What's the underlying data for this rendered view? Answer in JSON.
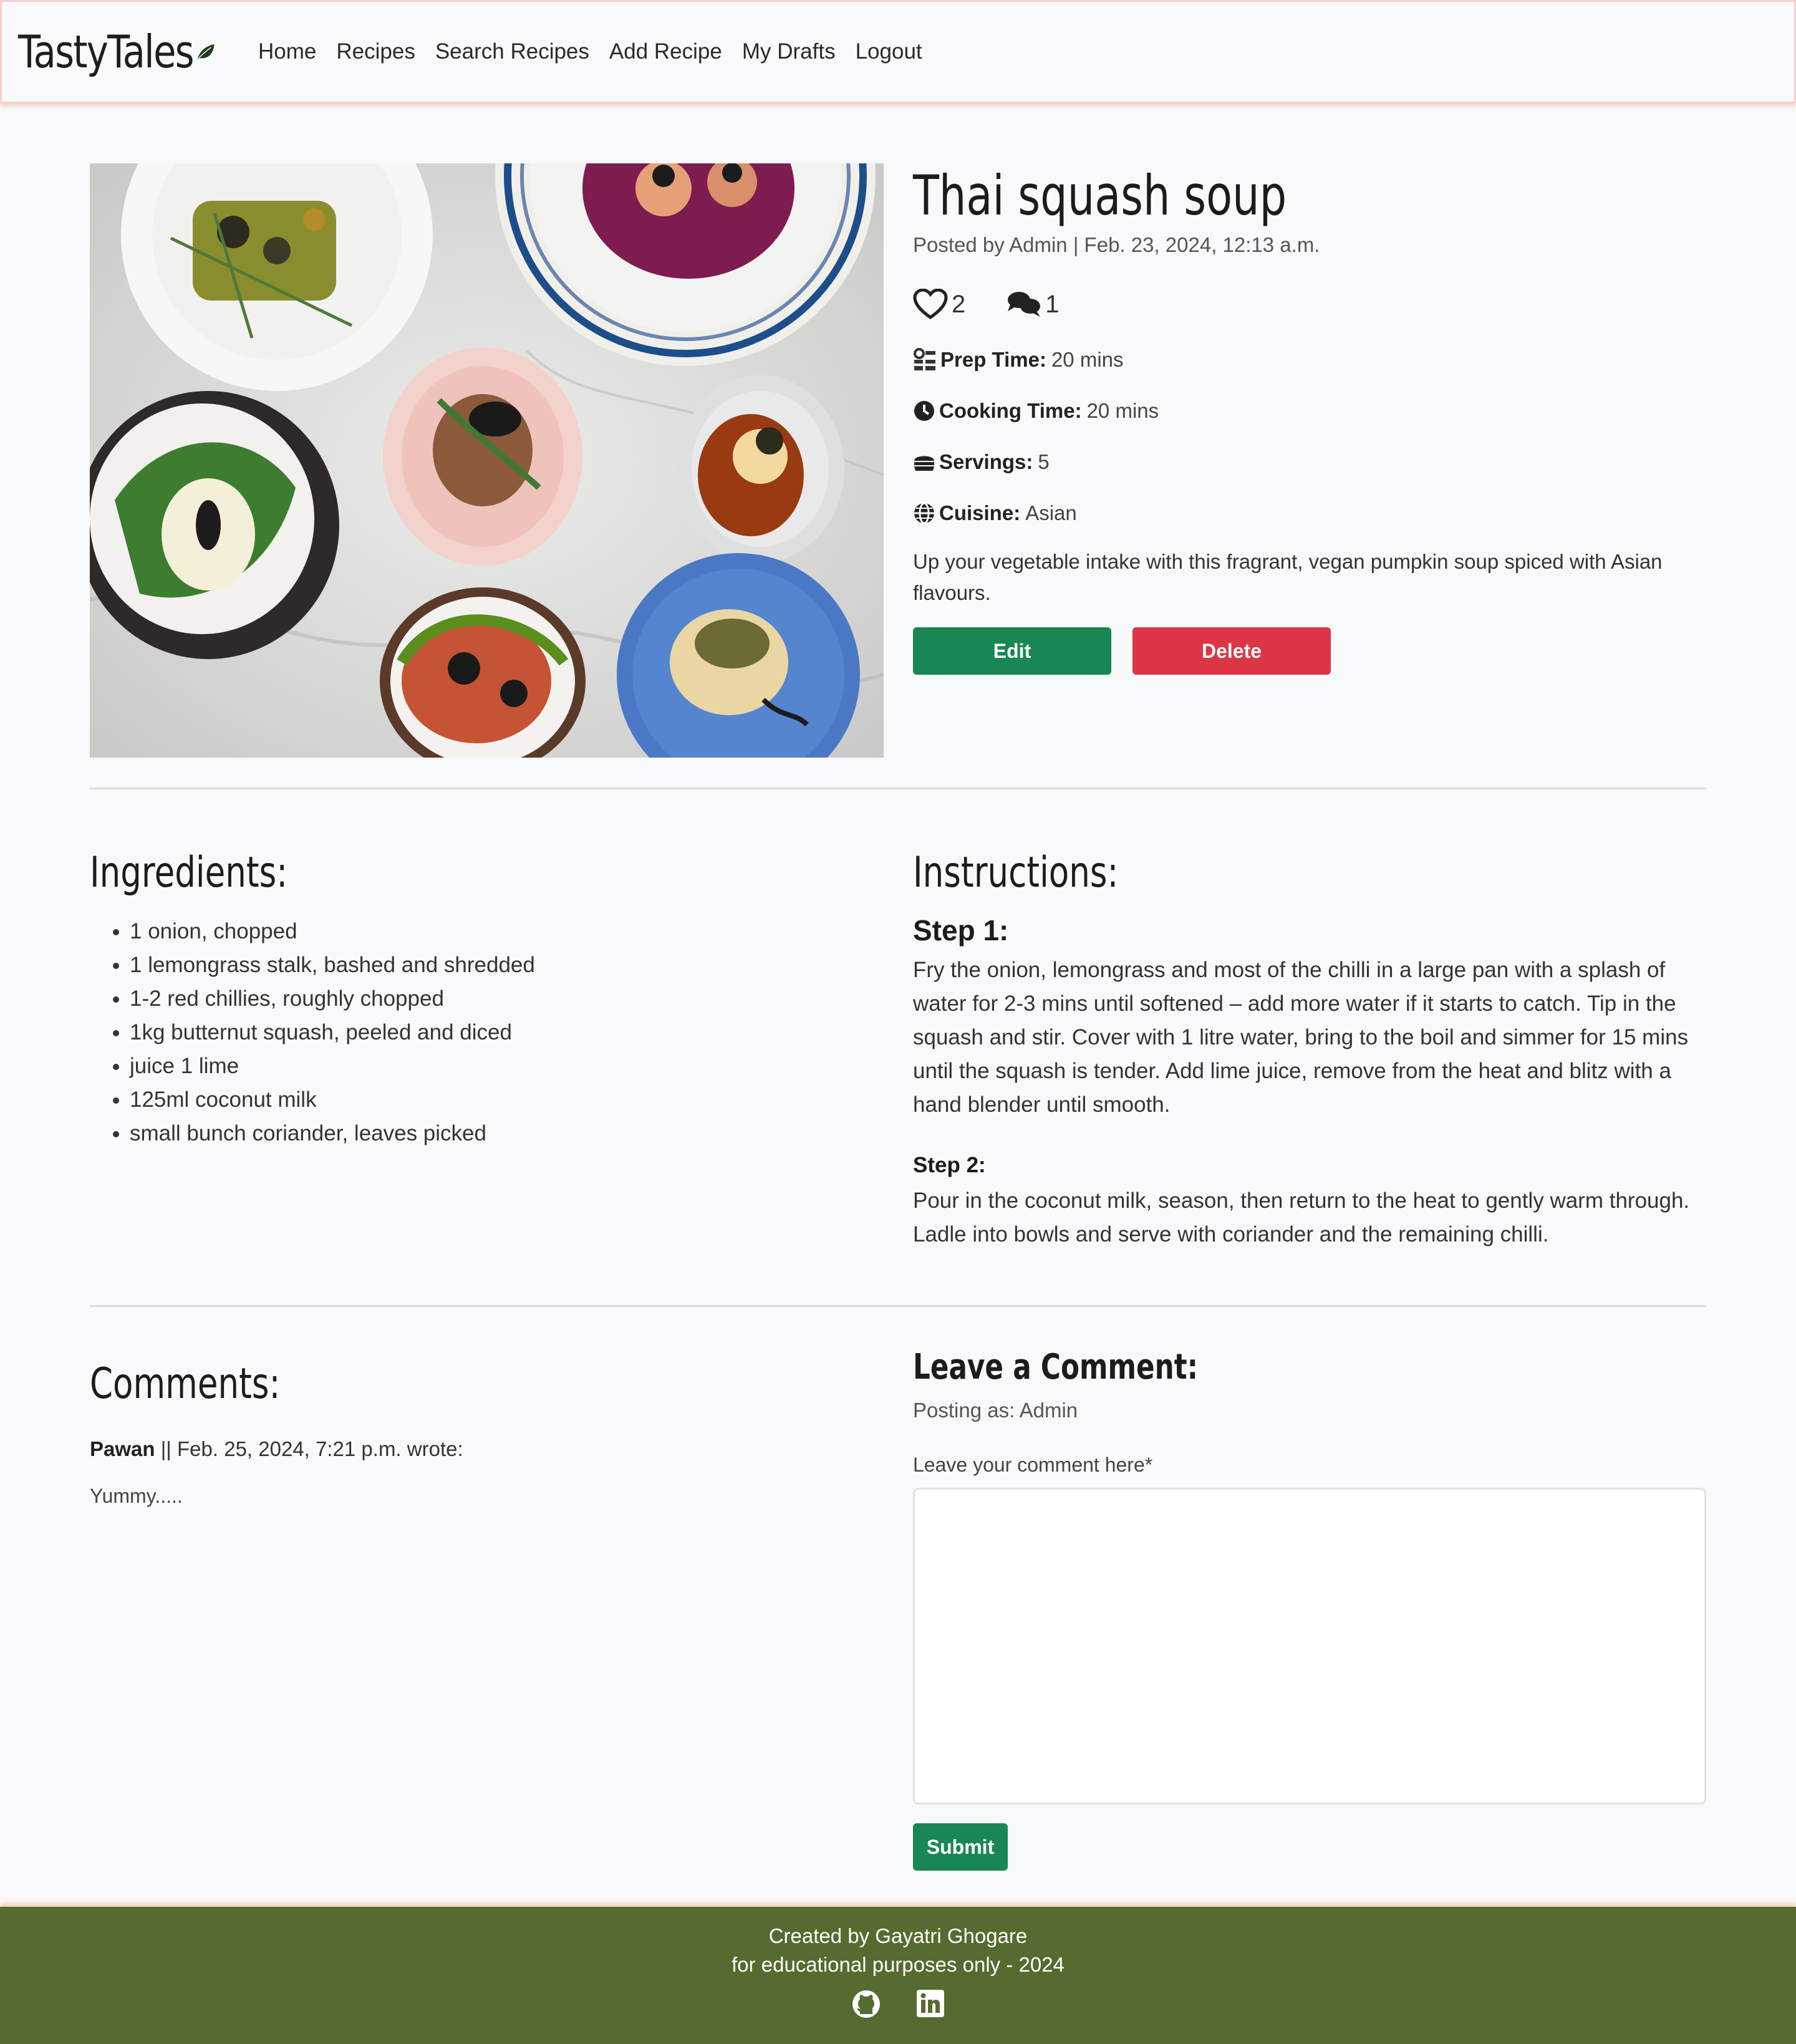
{
  "nav": {
    "brand": "TastyTales",
    "links": [
      "Home",
      "Recipes",
      "Search Recipes",
      "Add Recipe",
      "My Drafts",
      "Logout"
    ]
  },
  "recipe": {
    "title": "Thai squash soup",
    "posted": "Posted by Admin | Feb. 23, 2024, 12:13 a.m.",
    "likes": "2",
    "comments_count": "1",
    "prep_label": "Prep Time:",
    "prep_value": "20 mins",
    "cook_label": "Cooking Time:",
    "cook_value": "20 mins",
    "servings_label": "Servings:",
    "servings_value": "5",
    "cuisine_label": "Cuisine:",
    "cuisine_value": "Asian",
    "description": "Up your vegetable intake with this fragrant, vegan pumpkin soup spiced with Asian flavours.",
    "edit_label": "Edit",
    "delete_label": "Delete"
  },
  "ingredients": {
    "title": "Ingredients:",
    "items": [
      "1 onion, chopped",
      "1 lemongrass stalk, bashed and shredded",
      "1-2 red chillies, roughly chopped",
      "1kg butternut squash, peeled and diced",
      "juice 1 lime",
      "125ml coconut milk",
      "small bunch coriander, leaves picked"
    ]
  },
  "instructions": {
    "title": "Instructions:",
    "steps": [
      {
        "label": "Step 1:",
        "text": "Fry the onion, lemongrass and most of the chilli in a large pan with a splash of water for 2-3 mins until softened – add more water if it starts to catch. Tip in the squash and stir. Cover with 1 litre water, bring to the boil and simmer for 15 mins until the squash is tender. Add lime juice, remove from the heat and blitz with a hand blender until smooth."
      },
      {
        "label": "Step 2:",
        "text": "Pour in the coconut milk, season, then return to the heat to gently warm through. Ladle into bowls and serve with coriander and the remaining chilli."
      }
    ]
  },
  "comments": {
    "title": "Comments:",
    "items": [
      {
        "author": "Pawan",
        "meta": " || Feb. 25, 2024, 7:21 p.m. wrote:",
        "body": "Yummy....."
      }
    ]
  },
  "leave_comment": {
    "title": "Leave a Comment:",
    "posting_as": "Posting as: Admin",
    "field_label": "Leave your comment here*",
    "value": "",
    "submit_label": "Submit"
  },
  "footer": {
    "line1": "Created by Gayatri Ghogare",
    "line2": "for educational purposes only - 2024"
  },
  "colors": {
    "accent_green": "#198754",
    "danger_red": "#dc3545",
    "footer_olive": "#556b2f",
    "brand_leaf": "#1e3d1e"
  }
}
